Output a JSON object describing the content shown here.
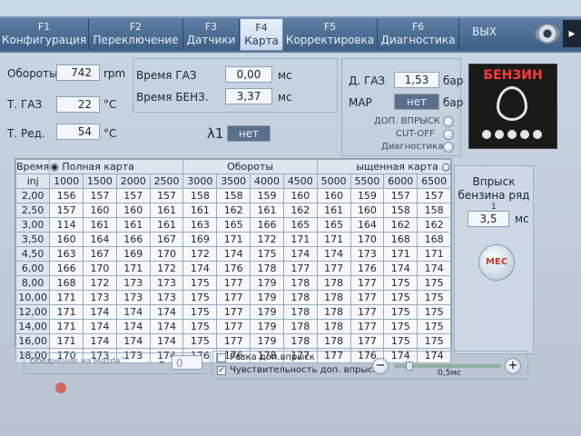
{
  "tabs": [
    {
      "key": "F1",
      "label": "Конфигурация"
    },
    {
      "key": "F2",
      "label": "Переключение"
    },
    {
      "key": "F3",
      "label": "Датчики"
    },
    {
      "key": "F4",
      "label": "Карта"
    },
    {
      "key": "F5",
      "label": "Корректировка"
    },
    {
      "key": "F6",
      "label": "Диагностика"
    }
  ],
  "exit_label": "ВЫХ",
  "params": {
    "rpm_label": "Обороты",
    "rpm_value": "742",
    "rpm_unit": "rpm",
    "tgas_label": "Т. ГАЗ",
    "tgas_value": "22",
    "tgas_unit": "°C",
    "tred_label": "Т. Ред.",
    "tred_value": "54",
    "tred_unit": "°C",
    "time_gas_label": "Время ГАЗ",
    "time_gas_value": "0,00",
    "time_gas_unit": "мс",
    "time_benz_label": "Время БЕНЗ.",
    "time_benz_value": "3,37",
    "time_benz_unit": "мс",
    "lambda_label": "λ1",
    "lambda_value": "нет",
    "pgas_label": "Д. ГАЗ",
    "pgas_value": "1,53",
    "pgas_unit": "бар",
    "map_label": "MAP",
    "map_value": "нет",
    "map_unit": "бар"
  },
  "options": [
    "ДОП. ВПРЫСК",
    "CUT-OFF",
    "Диагностика"
  ],
  "logo_text": "БЕНЗИН",
  "map": {
    "corner_top": "Время",
    "corner_bottom": "inj",
    "full_map_label": "Полная карта",
    "rpm_axis_label": "Обороты",
    "idle_map_label": "ыщенная карта",
    "rpm": [
      "1000",
      "1500",
      "2000",
      "2500",
      "3000",
      "3500",
      "4000",
      "4500",
      "5000",
      "5500",
      "6000",
      "6500"
    ],
    "rows": [
      {
        "inj": "2,00",
        "v": [
          "156",
          "157",
          "157",
          "157",
          "158",
          "158",
          "159",
          "160",
          "160",
          "159",
          "157",
          "157"
        ]
      },
      {
        "inj": "2,50",
        "v": [
          "157",
          "160",
          "160",
          "161",
          "161",
          "162",
          "161",
          "162",
          "161",
          "160",
          "158",
          "158"
        ]
      },
      {
        "inj": "3,00",
        "v": [
          "114",
          "161",
          "161",
          "161",
          "163",
          "165",
          "166",
          "165",
          "165",
          "164",
          "162",
          "162"
        ]
      },
      {
        "inj": "3,50",
        "v": [
          "160",
          "164",
          "166",
          "167",
          "169",
          "171",
          "172",
          "171",
          "171",
          "170",
          "168",
          "168"
        ]
      },
      {
        "inj": "4,50",
        "v": [
          "163",
          "167",
          "169",
          "170",
          "172",
          "174",
          "175",
          "174",
          "174",
          "173",
          "171",
          "171"
        ]
      },
      {
        "inj": "6,00",
        "v": [
          "166",
          "170",
          "171",
          "172",
          "174",
          "176",
          "178",
          "177",
          "177",
          "176",
          "174",
          "174"
        ]
      },
      {
        "inj": "8,00",
        "v": [
          "168",
          "172",
          "173",
          "173",
          "175",
          "177",
          "179",
          "178",
          "178",
          "177",
          "175",
          "175"
        ]
      },
      {
        "inj": "10,00",
        "v": [
          "171",
          "173",
          "173",
          "173",
          "175",
          "177",
          "179",
          "178",
          "178",
          "177",
          "175",
          "175"
        ]
      },
      {
        "inj": "12,00",
        "v": [
          "171",
          "174",
          "174",
          "174",
          "175",
          "177",
          "179",
          "178",
          "178",
          "177",
          "175",
          "175"
        ]
      },
      {
        "inj": "14,00",
        "v": [
          "171",
          "174",
          "174",
          "174",
          "175",
          "177",
          "179",
          "178",
          "178",
          "177",
          "175",
          "175"
        ]
      },
      {
        "inj": "16,00",
        "v": [
          "171",
          "174",
          "174",
          "174",
          "175",
          "177",
          "179",
          "178",
          "178",
          "177",
          "175",
          "175"
        ]
      },
      {
        "inj": "18,00",
        "v": [
          "170",
          "173",
          "173",
          "174",
          "176",
          "176",
          "178",
          "177",
          "177",
          "176",
          "174",
          "174"
        ]
      }
    ]
  },
  "injection": {
    "title": "Впрыск бензина ряд",
    "row_index": "1",
    "value": "3,5",
    "unit": "мс",
    "button_label": "МЕС"
  },
  "bottom": {
    "mazda_label": "Обеднение на Mazda™",
    "mazda_value": "0",
    "sharp_label": "Резка доп.впрыск",
    "sens_label": "Чувствительность доп. впрыск",
    "slider_value": "0,5мс",
    "slider_level": 0.12
  },
  "colors": {
    "tab_active": "#d5e2f1",
    "logo_text": "#ff3a3a"
  }
}
